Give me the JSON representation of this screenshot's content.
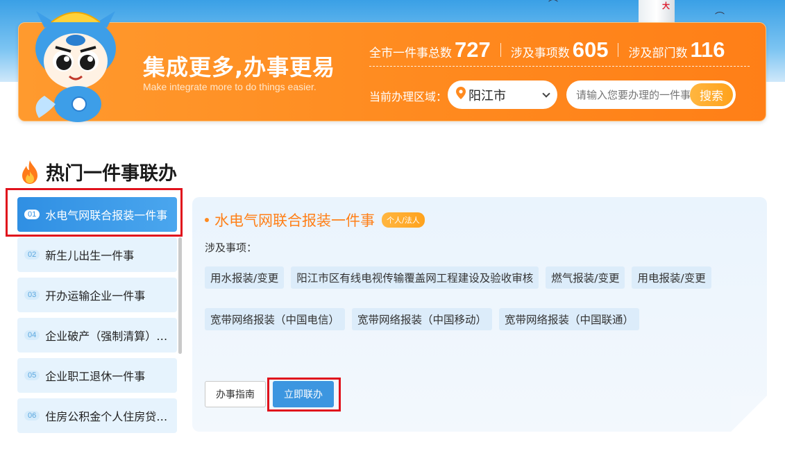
{
  "banner": {
    "slogan": "集成更多,办事更易",
    "slogan_en": "Make integrate more to do things easier.",
    "stats": [
      {
        "label": "全市一件事总数",
        "value": "727"
      },
      {
        "label": "涉及事项数",
        "value": "605"
      },
      {
        "label": "涉及部门数",
        "value": "116"
      }
    ],
    "region_label": "当前办理区域：",
    "region_value": "阳江市",
    "search_placeholder": "请输入您要办理的一件事",
    "search_button": "搜索"
  },
  "section": {
    "title": "热门一件事联办"
  },
  "list": [
    {
      "idx": "01",
      "label": "水电气网联合报装一件事"
    },
    {
      "idx": "02",
      "label": "新生儿出生一件事"
    },
    {
      "idx": "03",
      "label": "开办运输企业一件事"
    },
    {
      "idx": "04",
      "label": "企业破产（强制清算）一件事"
    },
    {
      "idx": "05",
      "label": "企业职工退休一件事"
    },
    {
      "idx": "06",
      "label": "住房公积金个人住房贷款一件事"
    }
  ],
  "detail": {
    "title": "水电气网联合报装一件事",
    "badge": "个人/法人",
    "involved_label": "涉及事项：",
    "tags": [
      "用水报装/变更",
      "阳江市区有线电视传输覆盖网工程建设及验收审核",
      "燃气报装/变更",
      "用电报装/变更",
      "宽带网络报装（中国电信）",
      "宽带网络报装（中国移动）",
      "宽带网络报装（中国联通）"
    ],
    "guide_button": "办事指南",
    "go_button": "立即联办"
  },
  "colors": {
    "banner_orange": "#ff8a1f",
    "active_blue": "#2f8fe3",
    "highlight_red": "#e0121c"
  }
}
